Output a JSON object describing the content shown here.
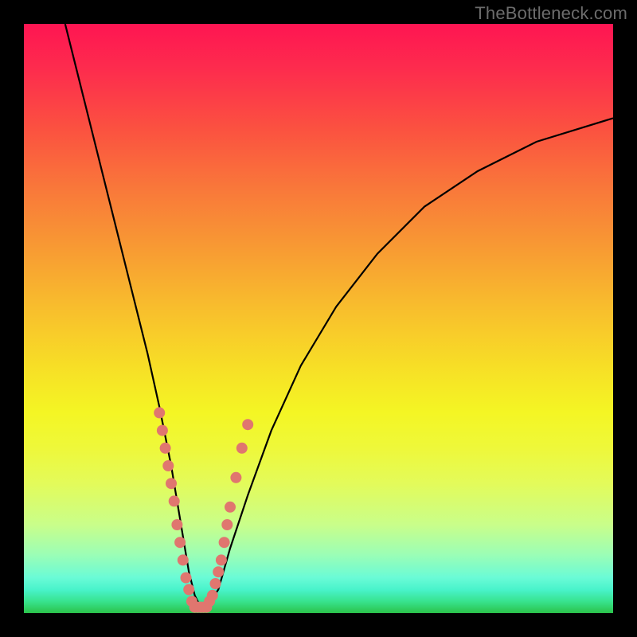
{
  "watermark": "TheBottleneck.com",
  "chart_data": {
    "type": "line",
    "title": "",
    "xlabel": "",
    "ylabel": "",
    "xlim": [
      0,
      100
    ],
    "ylim": [
      0,
      100
    ],
    "curve": {
      "name": "bottleneck-curve",
      "x": [
        7,
        9,
        11,
        13,
        15,
        17,
        19,
        21,
        23,
        25,
        26,
        27,
        28,
        29,
        30,
        31,
        33,
        35,
        38,
        42,
        47,
        53,
        60,
        68,
        77,
        87,
        100
      ],
      "y": [
        100,
        92,
        84,
        76,
        68,
        60,
        52,
        44,
        35,
        25,
        19,
        13,
        7,
        3,
        1,
        1,
        4,
        11,
        20,
        31,
        42,
        52,
        61,
        69,
        75,
        80,
        84
      ]
    },
    "points": {
      "name": "sample-dots",
      "color": "#e0766f",
      "radius_px": 7,
      "xy": [
        [
          23,
          34
        ],
        [
          23.5,
          31
        ],
        [
          24,
          28
        ],
        [
          24.5,
          25
        ],
        [
          25,
          22
        ],
        [
          25.5,
          19
        ],
        [
          26,
          15
        ],
        [
          26.5,
          12
        ],
        [
          27,
          9
        ],
        [
          27.5,
          6
        ],
        [
          28,
          4
        ],
        [
          28.5,
          2
        ],
        [
          29,
          1
        ],
        [
          29.5,
          1
        ],
        [
          30,
          1
        ],
        [
          30.5,
          1
        ],
        [
          31,
          1
        ],
        [
          31.5,
          2
        ],
        [
          32,
          3
        ],
        [
          32.5,
          5
        ],
        [
          33,
          7
        ],
        [
          33.5,
          9
        ],
        [
          34,
          12
        ],
        [
          34.5,
          15
        ],
        [
          35,
          18
        ],
        [
          36,
          23
        ],
        [
          37,
          28
        ],
        [
          38,
          32
        ]
      ]
    }
  }
}
